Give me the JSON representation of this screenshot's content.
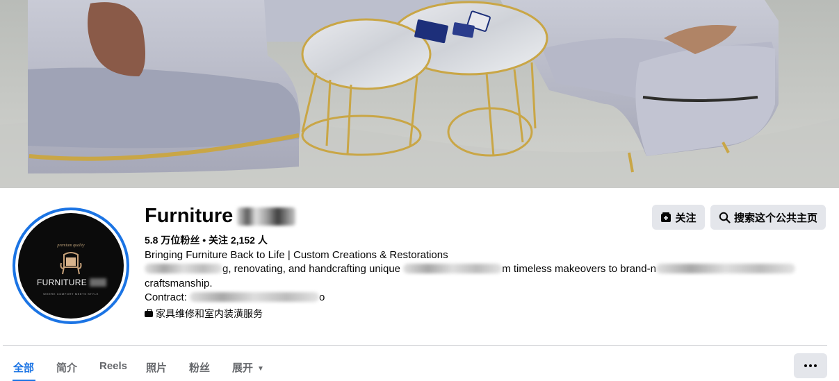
{
  "page": {
    "name": "Furniture",
    "stats": "5.8 万位粉丝 • 关注 2,152 人",
    "bio": {
      "line1": "Bringing Furniture Back to Life | Custom Creations & Restorations",
      "line2_part1": "g, renovating, and handcrafting unique",
      "line2_part2": "m timeless makeovers to brand-n",
      "line3": "craftsmanship.",
      "line4_label": "Contract:",
      "line4_tail": "o"
    },
    "category": "家具维修和室内装潢服务"
  },
  "avatar": {
    "top_text": "premium quality",
    "brand_text": "FURNITURE",
    "tagline": "WHERE COMFORT MEETS STYLE"
  },
  "actions": {
    "follow_label": "关注",
    "search_label": "搜索这个公共主页"
  },
  "tabs": [
    {
      "label": "全部",
      "active": true
    },
    {
      "label": "简介"
    },
    {
      "label": "Reels"
    },
    {
      "label": "照片"
    },
    {
      "label": "粉丝"
    },
    {
      "label": "展开"
    }
  ],
  "icons": {
    "follow": "follow-icon",
    "search": "search-icon",
    "category": "briefcase-icon",
    "more": "more-dots-icon",
    "expand": "caret-down-icon"
  },
  "colors": {
    "accent": "#1b74e4",
    "button_bg": "#e4e6eb",
    "secondary_text": "#65676b"
  }
}
